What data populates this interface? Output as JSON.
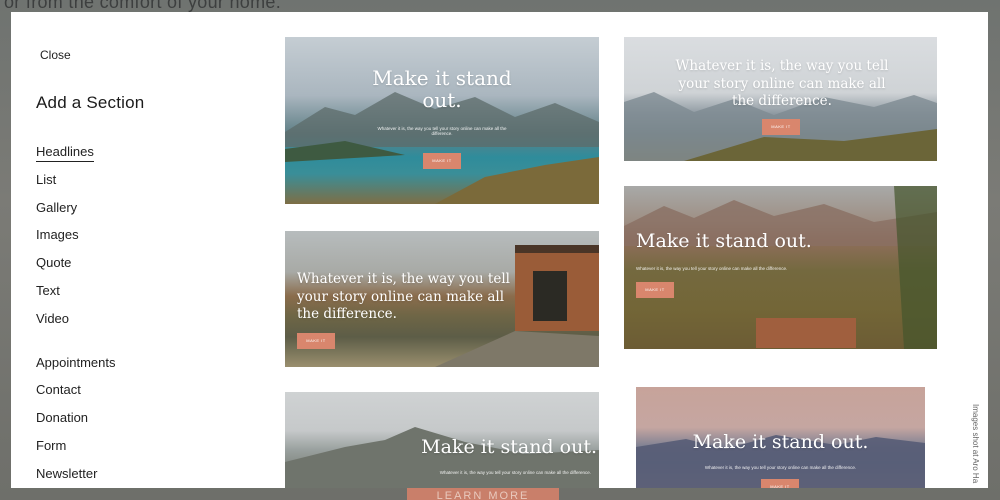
{
  "backdrop": {
    "text": "or from the comfort of your home.",
    "button_label": "LEARN MORE"
  },
  "modal": {
    "close_label": "Close",
    "title": "Add a Section",
    "nav_primary": [
      "Headlines",
      "List",
      "Gallery",
      "Images",
      "Quote",
      "Text",
      "Video"
    ],
    "nav_secondary": [
      "Appointments",
      "Contact",
      "Donation",
      "Form",
      "Newsletter"
    ],
    "active_item": "Headlines",
    "credit": "Images shot at Aro Ha"
  },
  "cards": [
    {
      "headline": "Make it stand out.",
      "subtext": "Whatever it is, the way you tell your story online can make all the difference.",
      "cta": "MAKE IT"
    },
    {
      "headline": "Whatever it is, the way you tell your story online can make all the difference.",
      "cta": "MAKE IT"
    },
    {
      "headline": "Whatever it is, the way you tell your story online can make all the difference.",
      "cta": "MAKE IT"
    },
    {
      "headline": "Make it stand out.",
      "subtext": "Whatever it is, the way you tell your story online can make all the difference.",
      "cta": "MAKE IT"
    },
    {
      "headline": "Make it stand out.",
      "subtext": "Whatever it is, the way you tell your story online can make all the difference."
    },
    {
      "headline": "Make it stand out.",
      "subtext": "Whatever it is, the way you tell your story online can make all the difference.",
      "cta": "MAKE IT"
    }
  ],
  "colors": {
    "accent": "#d9866d",
    "modal_bg": "#ffffff",
    "text": "#222222"
  }
}
